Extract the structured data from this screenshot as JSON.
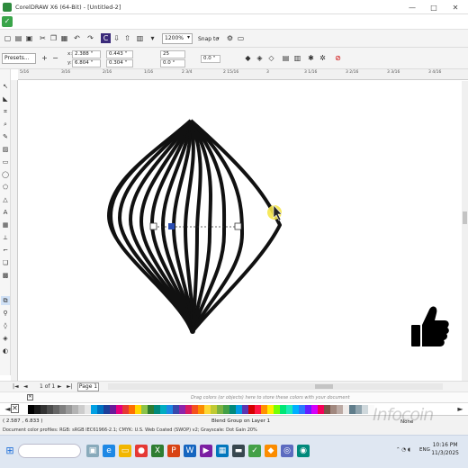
{
  "window": {
    "title": "CorelDRAW X6 (64-Bit) - [Untitled-2]",
    "minimize": "—",
    "maximize": "□",
    "close": "✕"
  },
  "toolbar": {
    "zoom": "1200%",
    "snap_to": "Snap to"
  },
  "property_bar": {
    "presets": "Presets...",
    "x": "2.388 \"",
    "y": "6.804 \"",
    "width": "0.443 \"",
    "height": "0.304 \"",
    "steps": "25",
    "offset": "0.0 \"",
    "angle": "0.0",
    "rotation": "0.0 °"
  },
  "ruler": {
    "ticks": [
      "5/16",
      "3/16",
      "2/16",
      "1/16",
      "2 3/4",
      "2 15/16",
      "3",
      "3 1/16",
      "3 2/16",
      "3 3/16",
      "3 4/16"
    ]
  },
  "pager": {
    "first": "|◄",
    "prev": "◄",
    "position": "1 of 1",
    "next": "►",
    "last": "►|",
    "add_page": "+",
    "tab_label": "Page 1"
  },
  "doc_palette_hint": "Drag colors (or objects) here to store these colors with your document",
  "palette": {
    "colors": [
      "#ffffff",
      "#000000",
      "#1a1a1a",
      "#333333",
      "#4d4d4d",
      "#666666",
      "#808080",
      "#999999",
      "#b3b3b3",
      "#cccccc",
      "#e6e6e6",
      "#00a0e3",
      "#0070c0",
      "#1d3f99",
      "#6a1b9a",
      "#e6007e",
      "#e53935",
      "#ff6f00",
      "#ffd600",
      "#8bc34a",
      "#2e7d32",
      "#00897b",
      "#00acc1",
      "#1e88e5",
      "#3949ab",
      "#8e24aa",
      "#d81b60",
      "#f4511e",
      "#fb8c00",
      "#fdd835",
      "#c0ca33",
      "#7cb342",
      "#43a047",
      "#00897b",
      "#039be5",
      "#5e35b1",
      "#d50000",
      "#ff1744",
      "#ff9100",
      "#ffea00",
      "#76ff03",
      "#00e676",
      "#1de9b6",
      "#00b0ff",
      "#2979ff",
      "#651fff",
      "#d500f9",
      "#f50057",
      "#795548",
      "#a1887f",
      "#bcaaa4",
      "#efebe9",
      "#607d8b",
      "#90a4ae",
      "#cfd8dc",
      "#fafafa"
    ]
  },
  "status": {
    "coords": "( 2.587 , 6.833 )",
    "object": "Blend Group on Layer 1",
    "profile": "Document color profiles: RGB: sRGB IEC61966-2.1; CMYK: U.S. Web Coated (SWOP) v2; Grayscale: Dot Gain 20%",
    "fill": "None"
  },
  "watermark": "Infocoin",
  "taskbar": {
    "tray_lang": "ENG",
    "time": "10:16 PM",
    "date": "11/3/2025"
  }
}
